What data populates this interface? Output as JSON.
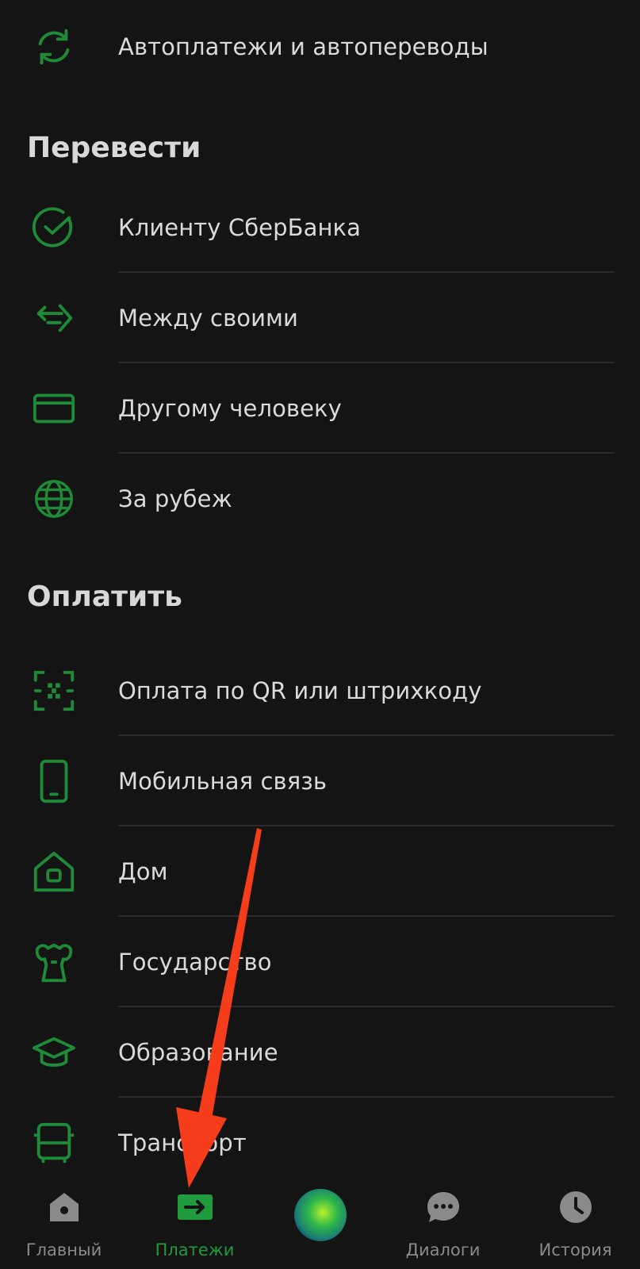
{
  "top_item": {
    "label": "Автоплатежи и автопереводы",
    "icon": "autopay-refresh-icon"
  },
  "sections": {
    "transfer": {
      "title": "Перевести",
      "items": [
        {
          "label": "Клиенту СберБанка",
          "icon": "sber-logo-icon"
        },
        {
          "label": "Между своими",
          "icon": "arrows-exchange-icon"
        },
        {
          "label": "Другому человеку",
          "icon": "card-icon"
        },
        {
          "label": "За рубеж",
          "icon": "globe-icon"
        }
      ]
    },
    "pay": {
      "title": "Оплатить",
      "items": [
        {
          "label": "Оплата по QR или штрихкоду",
          "icon": "qr-scan-icon"
        },
        {
          "label": "Мобильная связь",
          "icon": "phone-icon"
        },
        {
          "label": "Дом",
          "icon": "home-icon"
        },
        {
          "label": "Государство",
          "icon": "state-emblem-icon"
        },
        {
          "label": "Образование",
          "icon": "graduation-cap-icon"
        },
        {
          "label": "Транспорт",
          "icon": "bus-icon"
        }
      ]
    }
  },
  "bottom_nav": [
    {
      "label": "Главный",
      "icon": "home-nav-icon",
      "active": false
    },
    {
      "label": "Платежи",
      "icon": "payments-arrow-icon",
      "active": true
    },
    {
      "label": "",
      "icon": "assistant-orb-icon",
      "active": false
    },
    {
      "label": "Диалоги",
      "icon": "chat-icon",
      "active": false
    },
    {
      "label": "История",
      "icon": "clock-icon",
      "active": false
    }
  ],
  "colors": {
    "background": "#141414",
    "icon_green": "#1f8a37",
    "active_green": "#1f9a3c",
    "text": "#dadada",
    "muted": "#8a8a8a",
    "annotation_arrow": "#f53d1b"
  }
}
